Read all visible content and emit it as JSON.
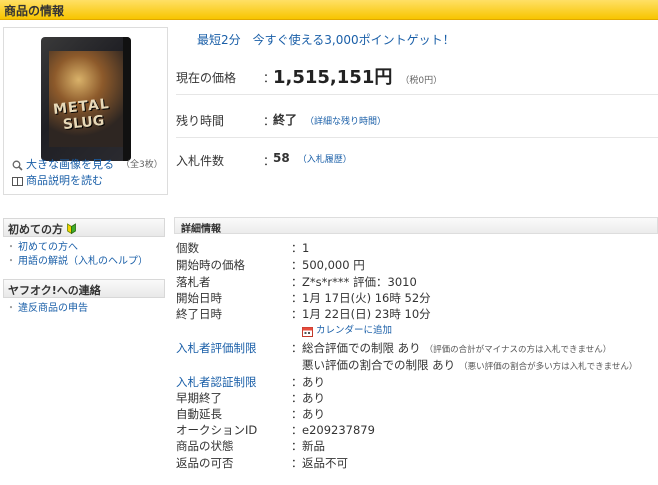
{
  "header": {
    "title": "商品の情報"
  },
  "images": {
    "photo_logo_line1": "METAL",
    "photo_logo_line2": "SLUG",
    "view_large_link": "大きな画像を見る",
    "image_count": "（全3枚）",
    "read_description_link": "商品説明を読む"
  },
  "promo": {
    "text": "最短2分　今すぐ使える3,000ポイントゲット！"
  },
  "stats": {
    "price_label": "現在の価格",
    "price_value": "1,515,151円",
    "price_tax": "（税0円）",
    "time_label": "残り時間",
    "time_value": "終了",
    "time_link": "（詳細な残り時間）",
    "bids_label": "入札件数",
    "bids_value": "58",
    "bids_link": "（入札履歴）",
    "colon": "："
  },
  "sidebar": {
    "beginner_title": "初めての方",
    "beginner_items": [
      "初めての方へ",
      "用語の解説（入札のヘルプ）"
    ],
    "contact_title": "ヤフオク!への連絡",
    "contact_items": [
      "違反商品の申告"
    ]
  },
  "details": {
    "title": "詳細情報",
    "colon": "：",
    "rows": [
      {
        "label": "個数",
        "value": "1"
      },
      {
        "label": "開始時の価格",
        "value": "500,000 円"
      },
      {
        "label": "落札者",
        "value": "Z*s*r*** 評価：3010"
      },
      {
        "label": "開始日時",
        "value": "1月 17日(火) 16時 52分"
      },
      {
        "label": "終了日時",
        "value": "1月 22日(日) 23時 10分"
      }
    ],
    "calendar_link": "カレンダーに追加",
    "rating_limit_label": "入札者評価制限",
    "rating_limit_line1": "総合評価での制限 あり",
    "rating_limit_note1": "（評価の合計がマイナスの方は入札できません）",
    "rating_limit_line2": "悪い評価の割合での制限 あり",
    "rating_limit_note2": "（悪い評価の割合が多い方は入札できません）",
    "rows2": [
      {
        "label": "入札者認証制限",
        "value": "あり",
        "link": true
      },
      {
        "label": "早期終了",
        "value": "あり"
      },
      {
        "label": "自動延長",
        "value": "あり"
      },
      {
        "label": "オークションID",
        "value": "e209237879"
      },
      {
        "label": "商品の状態",
        "value": "新品"
      },
      {
        "label": "返品の可否",
        "value": "返品不可"
      }
    ]
  }
}
